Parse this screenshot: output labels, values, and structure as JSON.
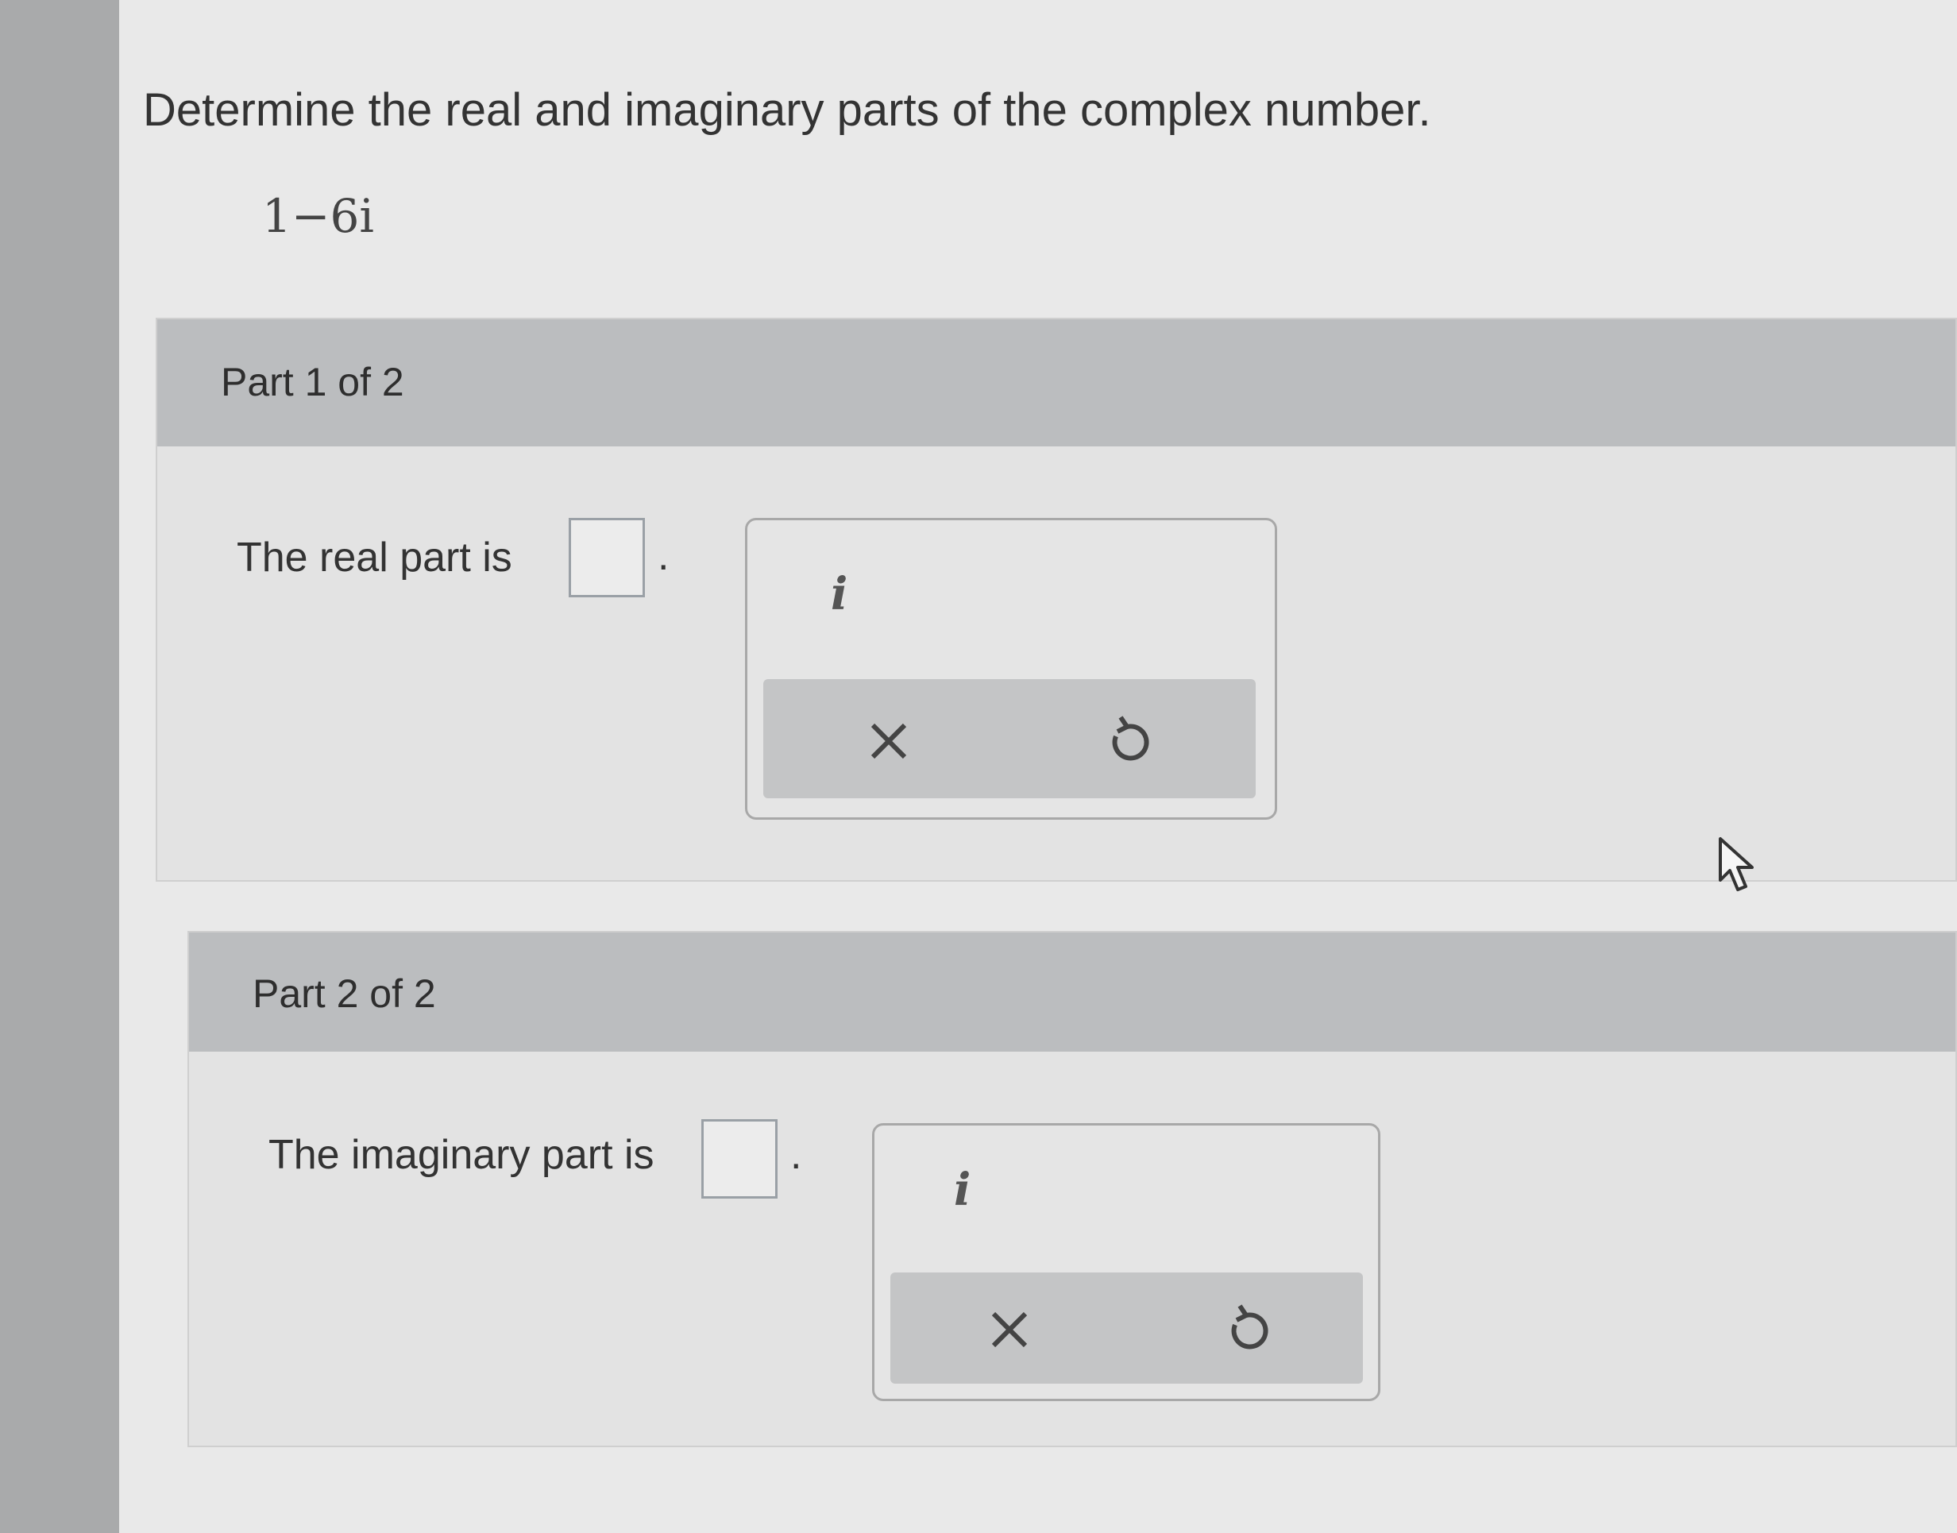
{
  "question": {
    "instruction": "Determine the real and imaginary parts of the complex number.",
    "expression": "1−6i"
  },
  "parts": [
    {
      "title": "Part 1 of 2",
      "prompt": "The real part is",
      "answer_value": "",
      "end_punct": ".",
      "tool_i_label": "i"
    },
    {
      "title": "Part 2 of 2",
      "prompt": "The imaginary part is",
      "answer_value": "",
      "end_punct": ".",
      "tool_i_label": "i"
    }
  ],
  "icons": {
    "clear": "close-icon",
    "undo": "undo-icon",
    "cursor": "mouse-pointer-icon"
  }
}
